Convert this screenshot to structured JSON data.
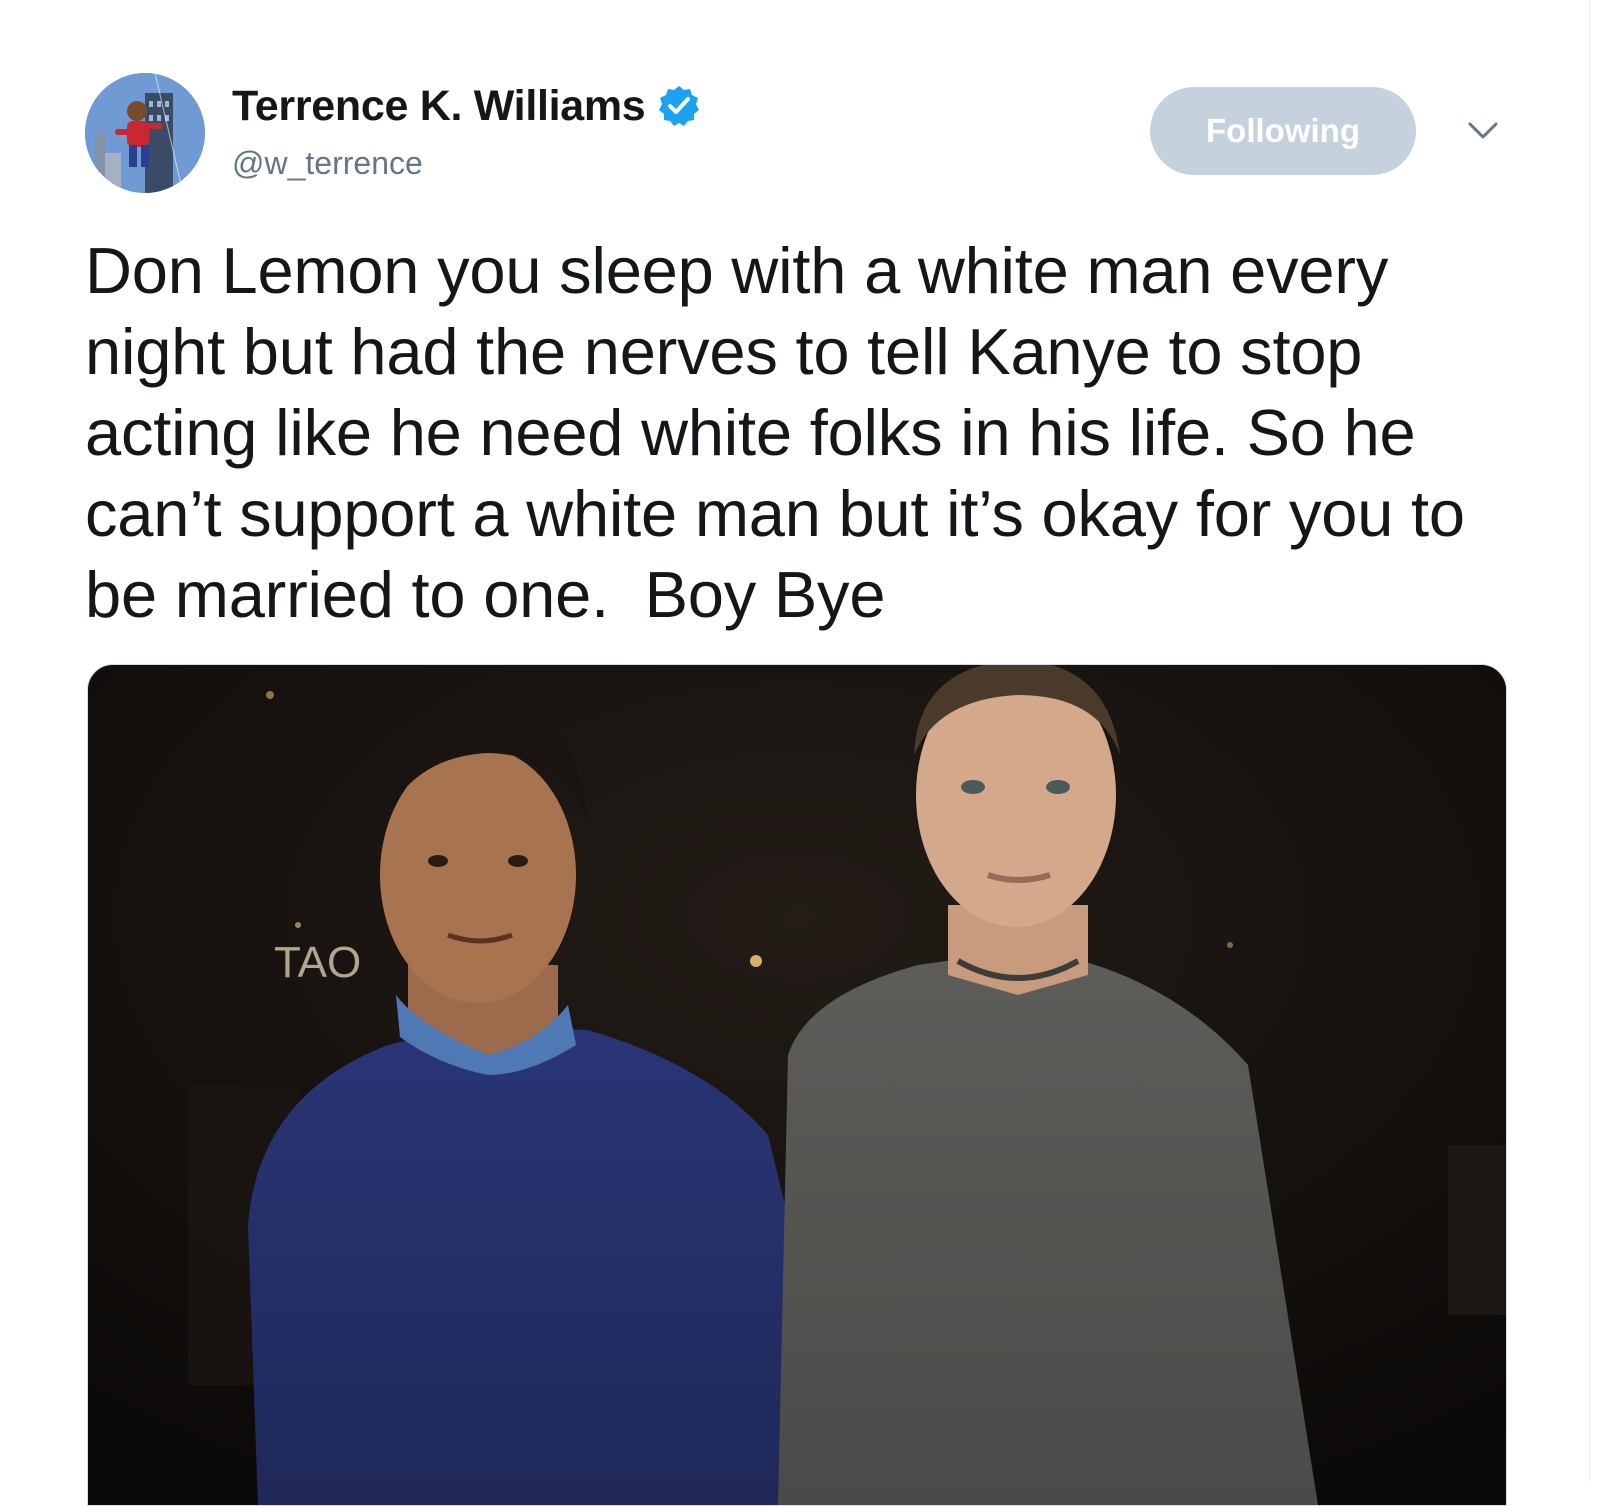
{
  "tweet": {
    "author": {
      "display_name": "Terrence K. Williams",
      "handle": "@w_terrence",
      "verified": true,
      "avatar_icon": "avatar-spiderman-icon"
    },
    "follow_button_label": "Following",
    "menu_icon": "chevron-down-icon",
    "text": "Don Lemon you sleep with a white man every night but had the nerves to tell Kanye to stop acting like he need white folks in his life. So he can’t support a white man but it’s okay for you to be married to one.  Boy Bye",
    "media": {
      "sign_text": "TAO"
    }
  },
  "colors": {
    "text": "#14171a",
    "secondary_text": "#657786",
    "verified_blue": "#1da1f2",
    "following_button_bg": "#c5d1dd"
  }
}
